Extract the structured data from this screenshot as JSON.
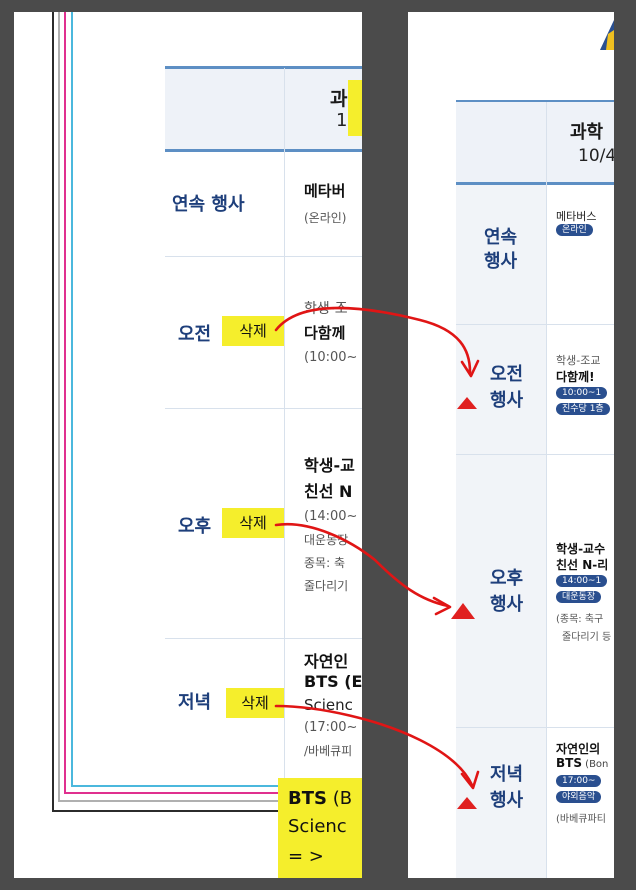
{
  "left": {
    "header": {
      "title": "과",
      "subtitle": "10/"
    },
    "rows": {
      "continuous": {
        "label": "연속 행사",
        "line1": "메타버",
        "line2": "(온라인)"
      },
      "morning": {
        "label": "오전",
        "line1": "학생-조",
        "line2": "다함께",
        "line3": "(10:00~"
      },
      "afternoon": {
        "label": "오후",
        "line1": "학생-교",
        "line2": "친선 N",
        "line3": "(14:00~",
        "line4": "대운동장",
        "line5": "종목: 축",
        "line6": "줄다리기"
      },
      "evening": {
        "label": "저녁",
        "line1": "자연인",
        "line2": "BTS (E",
        "line3": "Scienc",
        "line4": "(17:00~",
        "line5": "/바베큐피"
      }
    },
    "delete_labels": {
      "morning": "삭제",
      "afternoon": "삭제",
      "evening": "삭제"
    },
    "note": {
      "line1_bold": "BTS",
      "line1_rest": " (B",
      "line2": "Scienc",
      "line3": "= >"
    }
  },
  "right": {
    "header": {
      "title": "과학",
      "subtitle": "10/4"
    },
    "rows": {
      "continuous": {
        "label1": "연속",
        "label2": "행사",
        "line1": "메타버스",
        "pill1": "온라인"
      },
      "morning": {
        "label1": "오전",
        "label2": "행사",
        "line1": "학생-조교",
        "line2": "다함께!",
        "pill1": "10:00~1",
        "pill2": "진수당 1층"
      },
      "afternoon": {
        "label1": "오후",
        "label2": "행사",
        "line1": "학생-교수",
        "line2": "친선 N-리",
        "pill1": "14:00~1",
        "pill2": "대운동장",
        "line3": "(종목: 축구",
        "line4": "줄다리기 등"
      },
      "evening": {
        "label1": "저녁",
        "label2": "행사",
        "line1": "자연인의",
        "line2": "BTS",
        "line2_small": " (Bon",
        "pill1": "17:00~",
        "pill2": "야외음악",
        "line3": "(바베큐파티"
      }
    }
  },
  "colors": {
    "highlight": "#f5ee2c",
    "accent_blue": "#1e3f7b",
    "pill": "#2a4f8f",
    "arrow": "#e01515",
    "triangle": "#e02020"
  },
  "icons": [
    "red-curved-arrow",
    "red-triangle-icon"
  ]
}
